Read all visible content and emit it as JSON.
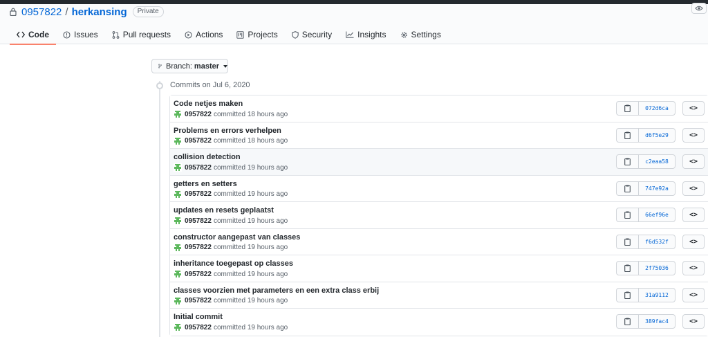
{
  "repo": {
    "owner": "0957822",
    "separator": "/",
    "name": "herkansing",
    "visibility": "Private"
  },
  "tabs": [
    {
      "label": "Code",
      "icon": "code-icon",
      "active": true
    },
    {
      "label": "Issues",
      "icon": "issue-icon"
    },
    {
      "label": "Pull requests",
      "icon": "pull-request-icon"
    },
    {
      "label": "Actions",
      "icon": "play-icon"
    },
    {
      "label": "Projects",
      "icon": "project-icon"
    },
    {
      "label": "Security",
      "icon": "shield-icon"
    },
    {
      "label": "Insights",
      "icon": "graph-icon"
    },
    {
      "label": "Settings",
      "icon": "gear-icon"
    }
  ],
  "branch": {
    "prefix": "Branch:",
    "name": "master"
  },
  "commit_group": {
    "title": "Commits on Jul 6, 2020"
  },
  "commits": [
    {
      "message": "Code netjes maken",
      "author": "0957822",
      "action": "committed",
      "time": "18 hours ago",
      "sha": "072d6ca"
    },
    {
      "message": "Problems en errors verhelpen",
      "author": "0957822",
      "action": "committed",
      "time": "18 hours ago",
      "sha": "d6f5e29"
    },
    {
      "message": "collision detection",
      "author": "0957822",
      "action": "committed",
      "time": "19 hours ago",
      "sha": "c2eaa58"
    },
    {
      "message": "getters en setters",
      "author": "0957822",
      "action": "committed",
      "time": "19 hours ago",
      "sha": "747e92a"
    },
    {
      "message": "updates en resets geplaatst",
      "author": "0957822",
      "action": "committed",
      "time": "19 hours ago",
      "sha": "66ef96e"
    },
    {
      "message": "constructor aangepast van classes",
      "author": "0957822",
      "action": "committed",
      "time": "19 hours ago",
      "sha": "f6d532f"
    },
    {
      "message": "inheritance toegepast op classes",
      "author": "0957822",
      "action": "committed",
      "time": "19 hours ago",
      "sha": "2f75036"
    },
    {
      "message": "classes voorzien met parameters en een extra class erbij",
      "author": "0957822",
      "action": "committed",
      "time": "19 hours ago",
      "sha": "31a9112"
    },
    {
      "message": "Initial commit",
      "author": "0957822",
      "action": "committed",
      "time": "19 hours ago",
      "sha": "389fac4"
    }
  ],
  "browse_label": "<>",
  "colors": {
    "link": "#0366d6",
    "active_tab_underline": "#f9826c",
    "avatar": "#5cb85c"
  }
}
